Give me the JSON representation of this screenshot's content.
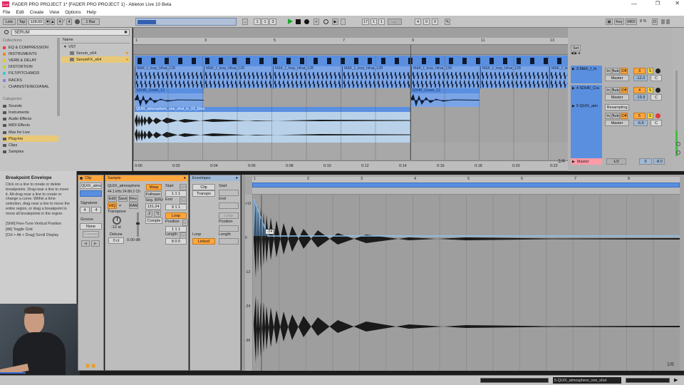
{
  "window": {
    "title": "FADER PRO PROJECT 1* [FADER PRO PROJECT 1] - Ableton Live 10 Beta",
    "app_icon": "Live"
  },
  "menu": [
    "File",
    "Edit",
    "Create",
    "View",
    "Options",
    "Help"
  ],
  "transport": {
    "link": "Link",
    "tap": "Tap",
    "tempo": "128.00",
    "sig_num": "4",
    "sig_den": "4",
    "quant": "1 Bar",
    "pos_bar": "1",
    "pos_beat": "1",
    "pos_sixteenth": "3",
    "loop_start_bar": "17",
    "loop_start_beat": "1",
    "loop_start_six": "1",
    "loop_len_bar": "4",
    "loop_len_beat": "0",
    "loop_len_six": "0",
    "key": "Key",
    "midi": "MIDI",
    "cpu": "8 %",
    "d_label": "D"
  },
  "browser": {
    "search": "SERUM",
    "collections_title": "Collections",
    "collections": [
      {
        "label": "EQ & COMPRESSION",
        "color": "#e8403a"
      },
      {
        "label": "INSTRUMENTS",
        "color": "#f08a1c"
      },
      {
        "label": "VERB & DELAY",
        "color": "#f2c21b"
      },
      {
        "label": "DISTORTION",
        "color": "#a8d63a"
      },
      {
        "label": "FILT/PITCH/MOD",
        "color": "#3fc7e8"
      },
      {
        "label": "RACKS",
        "color": "#8a7fe6"
      },
      {
        "label": "CHAIN/STEREO/ANAL",
        "color": "#b5b5b5"
      }
    ],
    "categories_title": "Categories",
    "categories": [
      "Sounds",
      "Instruments",
      "Audio Effects",
      "MIDI Effects",
      "Max for Live",
      "Plug-Ins",
      "Clips",
      "Samples"
    ],
    "selected_category": "Plug-Ins",
    "name_header": "Name",
    "tree_root": "VST",
    "items": [
      "Serum_x64",
      "SerumFX_x64"
    ]
  },
  "arrangement": {
    "ruler": [
      "1",
      "3",
      "5",
      "7",
      "9",
      "11",
      "13"
    ],
    "ruler_time": [
      "0:00",
      "0:02",
      "0:04",
      "0:06",
      "0:08",
      "0:10",
      "0:12",
      "0:14",
      "0:16",
      "0:18",
      "0:20",
      "0:22"
    ],
    "clips": {
      "hihat": "M&K_f_loop_hihat_128",
      "crash": "SDHR_Crash_12",
      "atmos": "QUIX_atmosphere_one_shot_tv_03_Ebm"
    },
    "page_indicator": "1/4",
    "set_label": "Set"
  },
  "tracks": [
    {
      "name": "3 M&K_f_hi",
      "num": "3",
      "color": "#ffa63e",
      "in": "In",
      "auto": "Auto",
      "off": "Off",
      "route": "Master",
      "vol": "-12.0",
      "pan": "C"
    },
    {
      "name": "4 SDHR_Cra",
      "num": "4",
      "color": "#ffa63e",
      "in": "In",
      "auto": "Auto",
      "off": "Off",
      "route": "Master",
      "vol": "-19.9",
      "pan": "C"
    },
    {
      "name": "5 QUIX_atm",
      "num": "5",
      "color": "#ffa63e",
      "in": "In",
      "auto": "Auto",
      "off": "Off",
      "route": "Master",
      "vol": "-6.6",
      "pan": "C",
      "resampling": "Resampling"
    }
  ],
  "master": {
    "name": "Master",
    "route": "1/2",
    "vol": "0",
    "vol2": "-8.0"
  },
  "info": {
    "title": "Breakpoint Envelope",
    "text1": "Click on a line to create or delete breakpoints. Drag near a line to move it. Alt-drag near a line to create or change a curve. Within a time selection, drag near a line to move the entire region, or drag a breakpoint to move all breakpoints in the region.",
    "text2": "[Shift] Fine-Tune Vertical Position",
    "text3": "[Alt] Toggle Grid",
    "text4": "[Ctrl + Alt + Drag] Scroll Display"
  },
  "clip_panel": {
    "title": "Clip",
    "name": "QUIX_atmos",
    "signature_label": "Signature",
    "sig_num": "4",
    "sig_den": "4",
    "groove_label": "Groove",
    "groove": "None",
    "commit": "Commit"
  },
  "sample_panel": {
    "title": "Sample",
    "name": "QUIX_atmosphere",
    "info": "44.1 kHz 24 Bit 2 Ch",
    "edit": "Edit",
    "save": "Save",
    "rev": "Rev.",
    "hiq": "HiQ",
    "ram": "RAM",
    "warp": "Warp",
    "follower": "Follower",
    "seg_bpm_label": "Seg. BPM",
    "seg_bpm": "131.24",
    "x2": ":2",
    "half": "*2",
    "complex": "Comple",
    "transpose_label": "Transpose",
    "transpose": "-12 st",
    "detune_label": "Detune",
    "detune": "0 ct",
    "gain": "0.00 dB",
    "start_label": "Start",
    "start": "1  1  1",
    "end_label": "End",
    "end": "9  1  1",
    "loop": "Loop",
    "position_label": "Position",
    "position": "1  1  1",
    "length_label": "Length",
    "length": "8  0  0",
    "set": "Set"
  },
  "env_panel": {
    "title": "Envelopes",
    "source": "Clip",
    "control": "Transpo",
    "start_label": "Start",
    "end_label": "End",
    "loop": "Loop",
    "position_label": "Position",
    "length_label": "Length",
    "loop_label": "Loop",
    "linked": "Linked"
  },
  "editor": {
    "ruler": [
      "1",
      "2",
      "3",
      "4",
      "5",
      "6",
      "7",
      "8"
    ],
    "db": [
      "+12",
      "0",
      "-12",
      "-24",
      "-36"
    ],
    "tooltip": "-24",
    "page": "1/8"
  },
  "status": {
    "text": "5-QUIX_atmosphere_one_shot"
  },
  "colors": {
    "accent": "#ffa63e",
    "clip_blue": "#5a8fe0",
    "selected": "#e9c977"
  }
}
